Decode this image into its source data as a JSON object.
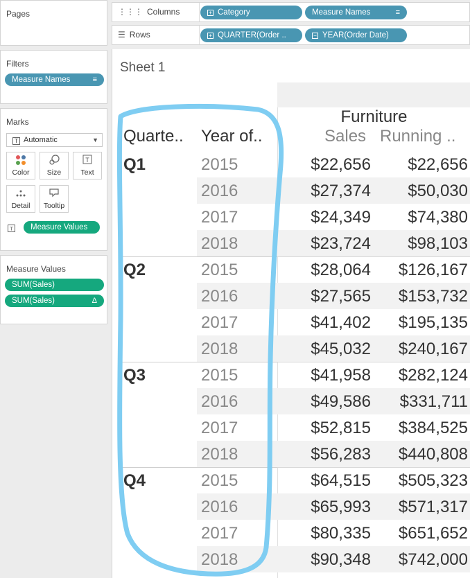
{
  "pages": {
    "title": "Pages"
  },
  "filters": {
    "title": "Filters",
    "pills": [
      {
        "label": "Measure Names"
      }
    ]
  },
  "marks": {
    "title": "Marks",
    "type_dropdown": "Automatic",
    "buttons": [
      {
        "label": "Color",
        "icon": "color-dots-icon"
      },
      {
        "label": "Size",
        "icon": "size-icon"
      },
      {
        "label": "Text",
        "icon": "text-icon"
      },
      {
        "label": "Detail",
        "icon": "detail-dots-icon"
      },
      {
        "label": "Tooltip",
        "icon": "tooltip-icon"
      }
    ],
    "text_pill": "Measure Values"
  },
  "measure_values": {
    "title": "Measure Values",
    "pills": [
      {
        "label": "SUM(Sales)"
      },
      {
        "label": "SUM(Sales)"
      }
    ]
  },
  "columns": {
    "label": "Columns",
    "pills": [
      {
        "label": "Category"
      },
      {
        "label": "Measure Names"
      }
    ]
  },
  "rows": {
    "label": "Rows",
    "pills": [
      {
        "label": "QUARTER(Order .."
      },
      {
        "label": "YEAR(Order Date)"
      }
    ]
  },
  "sheet": {
    "title": "Sheet 1",
    "category": "Furniture",
    "row_headers": [
      "Quarte..",
      "Year of.."
    ],
    "col_headers": [
      "Sales",
      "Running .."
    ],
    "quarters": [
      {
        "label": "Q1",
        "rows": [
          {
            "year": "2015",
            "sales": "$22,656",
            "running": "$22,656"
          },
          {
            "year": "2016",
            "sales": "$27,374",
            "running": "$50,030"
          },
          {
            "year": "2017",
            "sales": "$24,349",
            "running": "$74,380"
          },
          {
            "year": "2018",
            "sales": "$23,724",
            "running": "$98,103"
          }
        ]
      },
      {
        "label": "Q2",
        "rows": [
          {
            "year": "2015",
            "sales": "$28,064",
            "running": "$126,167"
          },
          {
            "year": "2016",
            "sales": "$27,565",
            "running": "$153,732"
          },
          {
            "year": "2017",
            "sales": "$41,402",
            "running": "$195,135"
          },
          {
            "year": "2018",
            "sales": "$45,032",
            "running": "$240,167"
          }
        ]
      },
      {
        "label": "Q3",
        "rows": [
          {
            "year": "2015",
            "sales": "$41,958",
            "running": "$282,124"
          },
          {
            "year": "2016",
            "sales": "$49,586",
            "running": "$331,711"
          },
          {
            "year": "2017",
            "sales": "$52,815",
            "running": "$384,525"
          },
          {
            "year": "2018",
            "sales": "$56,283",
            "running": "$440,808"
          }
        ]
      },
      {
        "label": "Q4",
        "rows": [
          {
            "year": "2015",
            "sales": "$64,515",
            "running": "$505,323"
          },
          {
            "year": "2016",
            "sales": "$65,993",
            "running": "$571,317"
          },
          {
            "year": "2017",
            "sales": "$80,335",
            "running": "$651,652"
          },
          {
            "year": "2018",
            "sales": "$90,348",
            "running": "$742,000"
          }
        ]
      }
    ]
  },
  "colors": {
    "pill_blue": "#4996b2",
    "pill_green": "#15a87e",
    "highlight": "#7fcdf2"
  }
}
